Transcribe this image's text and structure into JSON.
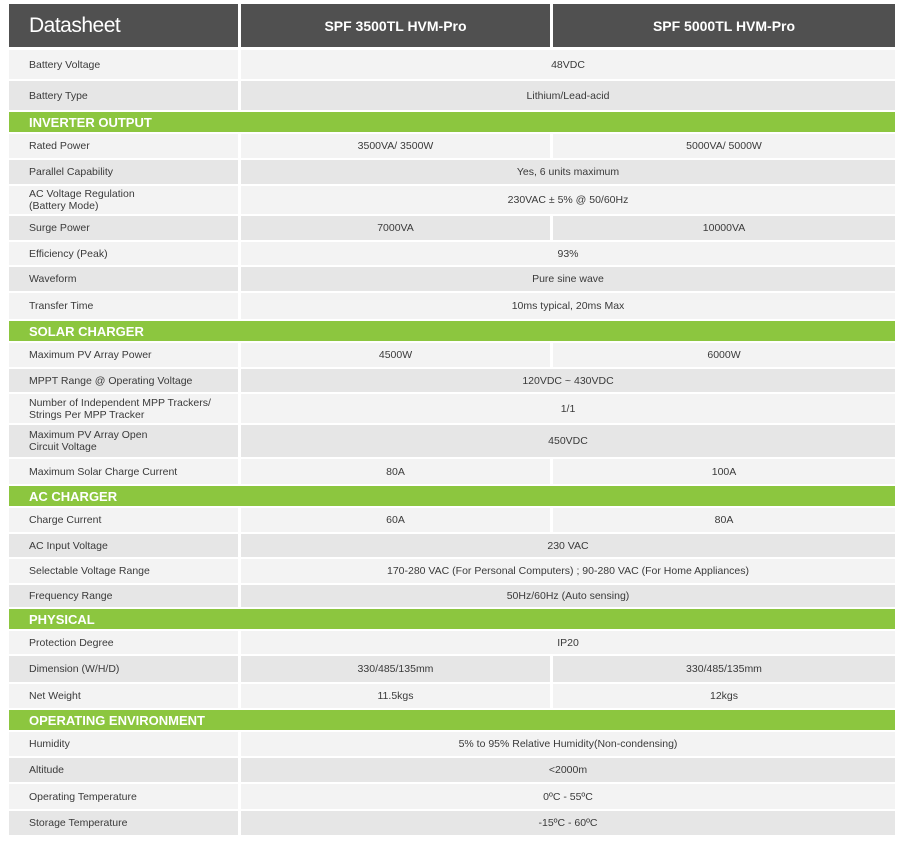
{
  "header": {
    "title": "Datasheet",
    "model_1": "SPF 3500TL HVM-Pro",
    "model_2": "SPF 5000TL HVM-Pro"
  },
  "sections": [
    {
      "title": "",
      "rows": [
        {
          "label": "Battery Voltage",
          "values": [
            "48VDC"
          ]
        },
        {
          "label": "Battery Type",
          "values": [
            "Lithium/Lead-acid"
          ]
        }
      ]
    },
    {
      "title": "INVERTER OUTPUT",
      "rows": [
        {
          "label": "Rated Power",
          "values": [
            "3500VA/ 3500W",
            "5000VA/ 5000W"
          ]
        },
        {
          "label": "Parallel Capability",
          "values": [
            "Yes, 6 units maximum"
          ]
        },
        {
          "label": "AC Voltage Regulation\n(Battery Mode)",
          "values": [
            "230VAC ± 5% @ 50/60Hz"
          ]
        },
        {
          "label": "Surge Power",
          "values": [
            "7000VA",
            "10000VA"
          ]
        },
        {
          "label": "Efficiency (Peak)",
          "values": [
            "93%"
          ]
        },
        {
          "label": "Waveform",
          "values": [
            "Pure sine wave"
          ]
        },
        {
          "label": "Transfer Time",
          "values": [
            "10ms typical, 20ms Max"
          ]
        }
      ]
    },
    {
      "title": "SOLAR CHARGER",
      "rows": [
        {
          "label": "Maximum PV Array Power",
          "values": [
            "4500W",
            "6000W"
          ]
        },
        {
          "label": "MPPT Range @ Operating Voltage",
          "values": [
            "120VDC ~ 430VDC"
          ]
        },
        {
          "label": "Number of Independent MPP Trackers/\nStrings Per MPP Tracker",
          "values": [
            "1/1"
          ]
        },
        {
          "label": "Maximum PV Array Open\nCircuit Voltage",
          "values": [
            "450VDC"
          ]
        },
        {
          "label": "Maximum Solar Charge Current",
          "values": [
            "80A",
            "100A"
          ]
        }
      ]
    },
    {
      "title": "AC CHARGER",
      "rows": [
        {
          "label": "Charge Current",
          "values": [
            "60A",
            "80A"
          ]
        },
        {
          "label": "AC Input Voltage",
          "values": [
            "230 VAC"
          ]
        },
        {
          "label": "Selectable Voltage Range",
          "values": [
            "170-280 VAC (For Personal Computers) ; 90-280 VAC (For Home Appliances)"
          ]
        },
        {
          "label": "Frequency Range",
          "values": [
            "50Hz/60Hz (Auto sensing)"
          ]
        }
      ]
    },
    {
      "title": "PHYSICAL",
      "rows": [
        {
          "label": "Protection Degree",
          "values": [
            "IP20"
          ]
        },
        {
          "label": "Dimension (W/H/D)",
          "values": [
            "330/485/135mm",
            "330/485/135mm"
          ]
        },
        {
          "label": "Net Weight",
          "values": [
            "11.5kgs",
            "12kgs"
          ]
        }
      ]
    },
    {
      "title": "OPERATING ENVIRONMENT",
      "rows": [
        {
          "label": "Humidity",
          "values": [
            "5% to 95% Relative Humidity(Non-condensing)"
          ]
        },
        {
          "label": "Altitude",
          "values": [
            "<2000m"
          ]
        },
        {
          "label": "Operating Temperature",
          "values": [
            "0ºC - 55ºC"
          ]
        },
        {
          "label": "Storage Temperature",
          "values": [
            "-15ºC - 60ºC"
          ]
        }
      ]
    }
  ]
}
